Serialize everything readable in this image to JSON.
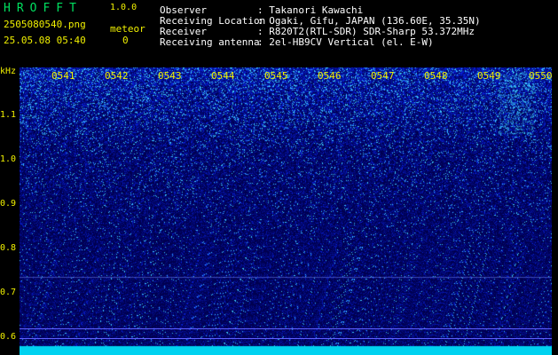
{
  "header": {
    "app_name": "HROFFT",
    "version": "1.0.0",
    "filename": "2505080540.png",
    "timestamp": "25.05.08 05:40",
    "meteor_label": "meteor",
    "meteor_count": "0",
    "info_labels": [
      "Observer",
      "Receiving Location",
      "Receiver",
      "Receiving antenna"
    ],
    "info_values": [
      ": Takanori Kawachi",
      ": Ogaki, Gifu, JAPAN (136.60E, 35.35N)",
      ": R820T2(RTL-SDR) SDR-Sharp 53.372MHz",
      ": 2el-HB9CV Vertical (el. E-W)"
    ]
  },
  "spectrogram": {
    "y_unit": "kHz",
    "y_ticks": [
      "1.1",
      "1.0",
      "0.9",
      "0.8",
      "0.7",
      "0.6"
    ],
    "x_ticks": [
      "0541",
      "0542",
      "0543",
      "0544",
      "0545",
      "0546",
      "0547",
      "0548",
      "0549",
      "0550"
    ],
    "colors": {
      "axis_text": "#f0f000",
      "noise": "#1e3cff",
      "trace": "#00e8ff"
    }
  }
}
